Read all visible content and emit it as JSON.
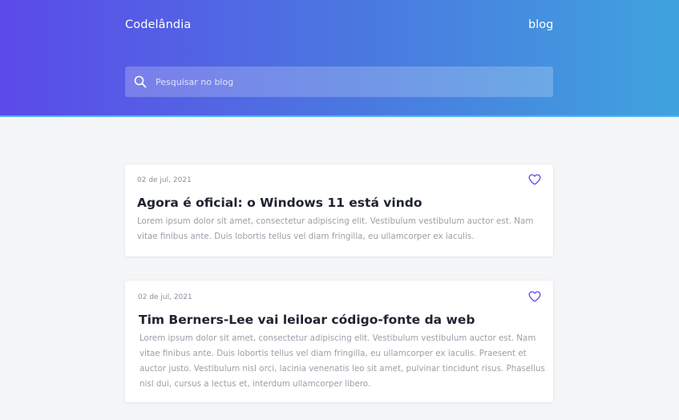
{
  "header": {
    "brand": "Codelândia",
    "nav_link": "blog",
    "search_placeholder": "Pesquisar no blog"
  },
  "colors": {
    "gradient_start": "#5b4ae9",
    "gradient_end": "#3fa3de",
    "accent": "#5b4ae9",
    "background": "#f4f5f7"
  },
  "posts": [
    {
      "date": "02 de jul, 2021",
      "title": "Agora é oficial: o Windows 11 está vindo",
      "excerpt": "Lorem ipsum dolor sit amet, consectetur adipiscing elit. Vestibulum vestibulum auctor est. Nam vitae finibus ante. Duis lobortis tellus vel diam fringilla, eu ullamcorper ex iaculis.",
      "icon": "heart-outline-icon"
    },
    {
      "date": "02 de jul, 2021",
      "title": "Tim Berners-Lee vai leiloar código-fonte da web",
      "excerpt": "Lorem ipsum dolor sit amet, consectetur adipiscing elit. Vestibulum vestibulum auctor est. Nam vitae finibus ante. Duis lobortis tellus vel diam fringilla, eu ullamcorper ex iaculis. Praesent et auctor justo. Vestibulum nisl orci, lacinia venenatis leo sit amet, pulvinar tincidunt risus. Phasellus nisl dui, cursus a lectus et, interdum ullamcorper libero.",
      "icon": "heart-outline-icon"
    }
  ]
}
